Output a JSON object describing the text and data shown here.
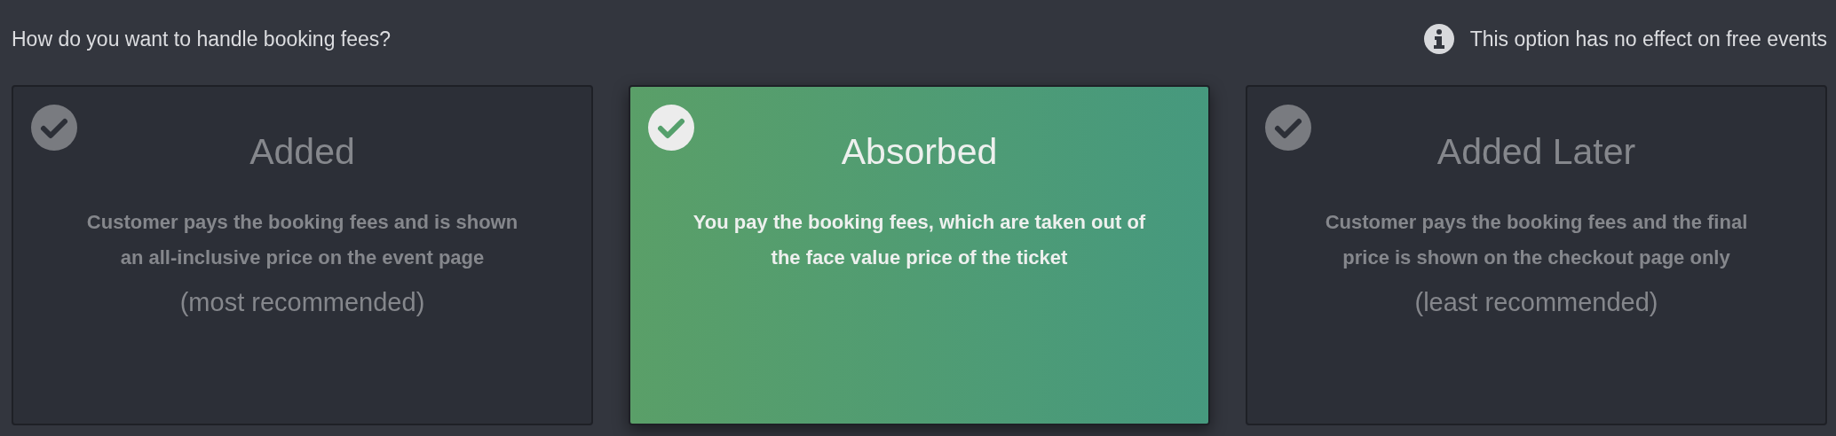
{
  "question": "How do you want to handle booking fees?",
  "note": "This option has no effect on free events",
  "options": [
    {
      "title": "Added",
      "description": "Customer pays the booking fees and is shown an all-inclusive price on the event page",
      "recommendation": "(most recommended)",
      "selected": false
    },
    {
      "title": "Absorbed",
      "description": "You pay the booking fees, which are taken out of the face value price of the ticket",
      "selected": true
    },
    {
      "title": "Added Later",
      "description": "Customer pays the booking fees and the final price is shown on the checkout page only",
      "recommendation": "(least recommended)",
      "selected": false
    }
  ]
}
